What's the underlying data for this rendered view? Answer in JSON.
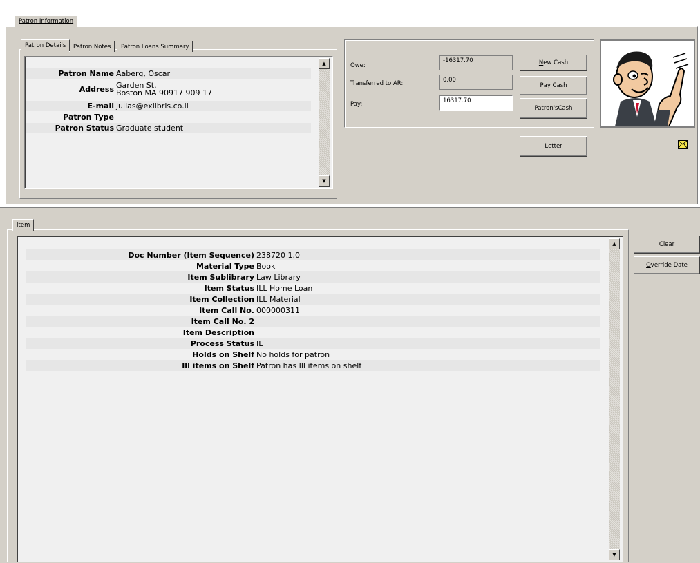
{
  "top_tab": "Patron Information",
  "patron_tabs": [
    "Patron Details",
    "Patron Notes",
    "Patron Loans Summary"
  ],
  "patron_details": [
    {
      "label": "Patron Name",
      "value": "Aaberg, Oscar"
    },
    {
      "label": "Address",
      "value": "Garden St.",
      "value2": "Boston MA 90917 909 17"
    },
    {
      "label": "E-mail",
      "value": "julias@exlibris.co.il"
    },
    {
      "label": "Patron Type",
      "value": ""
    },
    {
      "label": "Patron Status",
      "value": "Graduate student"
    }
  ],
  "cash": {
    "owe_label": "Owe:",
    "owe_value": "-16317.70",
    "transferred_label": "Transferred to AR:",
    "transferred_value": "0.00",
    "pay_label": "Pay:",
    "pay_value": "16317.70"
  },
  "buttons": {
    "new_cash_prefix": "N",
    "new_cash_rest": "ew Cash",
    "pay_cash_prefix": "P",
    "pay_cash_rest": "ay Cash",
    "patrons_cash_prefix": "Patron's ",
    "patrons_cash_u": "C",
    "patrons_cash_rest": "ash",
    "letter_prefix": "L",
    "letter_rest": "etter",
    "clear_prefix": "C",
    "clear_rest": "lear",
    "override_prefix": "O",
    "override_rest": "verride Date"
  },
  "item_tab": "Item",
  "item_details": [
    {
      "label": "Doc Number (Item Sequence)",
      "value": "238720 1.0"
    },
    {
      "label": "Material Type",
      "value": "Book"
    },
    {
      "label": "Item Sublibrary",
      "value": "Law Library"
    },
    {
      "label": "Item Status",
      "value": "ILL Home Loan"
    },
    {
      "label": "Item Collection",
      "value": "ILL Material"
    },
    {
      "label": "Item Call No.",
      "value": "000000311"
    },
    {
      "label": "Item Call No. 2",
      "value": ""
    },
    {
      "label": "Item Description",
      "value": ""
    },
    {
      "label": "Process Status",
      "value": "IL"
    },
    {
      "label": "Holds on Shelf",
      "value": "No holds for patron"
    },
    {
      "label": "Ill items on Shelf",
      "value": "Patron has Ill items on shelf"
    }
  ],
  "icons": {
    "patron_photo": "cartoon-man-pointing",
    "letter_icon": "envelope-icon"
  },
  "colors": {
    "panel": "#d4d0c8",
    "row_alt": "#e6e6e6",
    "list_bg": "#f0f0f0"
  }
}
